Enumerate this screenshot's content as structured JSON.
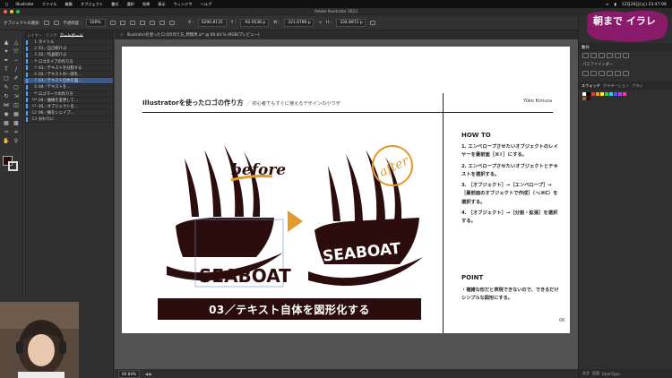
{
  "menubar": {
    "items": [
      "Illustrator",
      "ファイル",
      "編集",
      "オブジェクト",
      "書式",
      "選択",
      "効果",
      "表示",
      "ウィンドウ",
      "ヘルプ"
    ],
    "clock": "12月26日(火) 23:47:06"
  },
  "titlebar": {
    "title": "Adobe Illustrator 2023"
  },
  "controlbar": {
    "object_label": "オブジェクトの選択",
    "opacity_label": "不透明度 :",
    "opacity_value": "100%",
    "x_label": "X :",
    "x_value": "6290.8135",
    "y_label": "Y :",
    "y_value": "-92.9538 p",
    "w_label": "W :",
    "w_value": "321.6789 p",
    "h_label": "H :",
    "h_value": "334.8972 p"
  },
  "layers_panel": {
    "tabs": [
      "レイヤー",
      "リンク",
      "アートボード"
    ],
    "active_tab": "アートボード",
    "rows": [
      {
        "num": "1",
        "name": "タイトル"
      },
      {
        "num": "2",
        "name": "01／自己紹介ぶ"
      },
      {
        "num": "3",
        "name": "02／作品紹介ぶ"
      },
      {
        "num": "4",
        "name": "ロゴタイプの作り方"
      },
      {
        "num": "5",
        "name": "01／テキストを分割する"
      },
      {
        "num": "6",
        "name": "02／テキストの一部を…"
      },
      {
        "num": "7",
        "name": "03／テキスト自体を図…"
      },
      {
        "num": "8",
        "name": "04／テキストを…"
      },
      {
        "num": "9",
        "name": "ロゴマークの作り方"
      },
      {
        "num": "10",
        "name": "04／曲線を変更して…"
      },
      {
        "num": "11",
        "name": "05／オブジェクトを…"
      },
      {
        "num": "12",
        "name": "06／線をシェイプ…"
      },
      {
        "num": "13",
        "name": "おわりに"
      }
    ],
    "selected_index": 6
  },
  "document": {
    "tab_title": "Illustratorを使ったロゴの作り方_原稿用.ai* @ 60.84 % (RGB/プレビュー)"
  },
  "slide": {
    "title": "Illustratorを使ったロゴの作り方",
    "subtitle": "／ 初心者でもすぐに使えるデザインの小ワザ",
    "author": "Yûko Kimura",
    "before_label": "before",
    "after_label": "after",
    "logo_text": "SEABOAT",
    "banner": "03／テキスト自体を図形化する",
    "howto_heading": "HOW TO",
    "howto_steps": [
      "1. エンベロープさせたいオブジェクトのレイヤーを最前面［⌘⇧］にする。",
      "2. エンベロープさせたいオブジェクトとテキストを選択する。",
      "3. ［オブジェクト］→［エンベロープ］→［最前面のオブジェクトで作成］（⌥⌘C）を選択する。",
      "4. ［オブジェクト］→［分割・拡張］を選択する。"
    ],
    "point_heading": "POINT",
    "point_text": "・複雑な形だと表現できないので、できるだけシンプルな図形にする。",
    "page_number": "06"
  },
  "status": {
    "zoom": "60.84%"
  },
  "right_panel": {
    "tabs": [
      "整列",
      "パスファインダー"
    ],
    "pathfinder_label": "パスファインダー",
    "bottom_tabs": [
      "スウォッチ",
      "グラデーション",
      "ブラシ"
    ],
    "bottom_bar": [
      "文字",
      "段落",
      "OpenType"
    ]
  },
  "badge": {
    "text": "朝まで イラレ"
  },
  "colors": {
    "dark_brown": "#2b0d0d",
    "accent_orange": "#e39a2d"
  }
}
